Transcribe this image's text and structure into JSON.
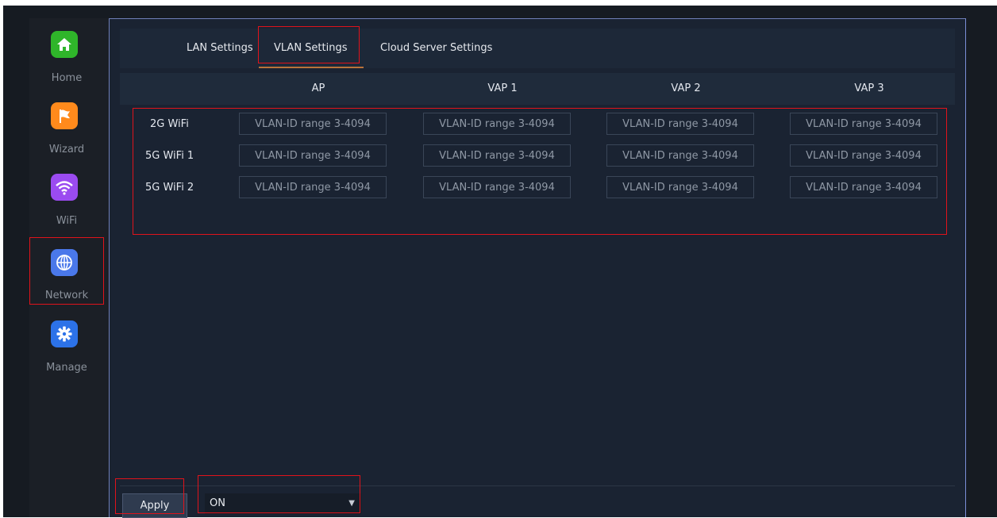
{
  "sidebar": {
    "items": [
      {
        "label": "Home",
        "icon": "home-icon",
        "color": "#2fb52a"
      },
      {
        "label": "Wizard",
        "icon": "flag-icon",
        "color": "#ff8a1c"
      },
      {
        "label": "WiFi",
        "icon": "wifi-icon",
        "color": "#9b4bf0"
      },
      {
        "label": "Network",
        "icon": "globe-icon",
        "color": "#4a78ea"
      },
      {
        "label": "Manage",
        "icon": "gear-icon",
        "color": "#2c72e8"
      }
    ],
    "active": "Network"
  },
  "tabs": {
    "lan": "LAN Settings",
    "vlan": "VLAN Settings",
    "cloud": "Cloud Server Settings",
    "active": "VLAN Settings"
  },
  "table": {
    "columns": [
      "AP",
      "VAP 1",
      "VAP 2",
      "VAP 3"
    ],
    "rows": [
      "2G WiFi",
      "5G WiFi 1",
      "5G WiFi 2"
    ],
    "placeholder": "VLAN-ID range 3-4094"
  },
  "footer": {
    "apply_label": "Apply",
    "select_value": "ON"
  },
  "colors": {
    "accent": "#b9733a",
    "highlight": "#e0131b"
  }
}
